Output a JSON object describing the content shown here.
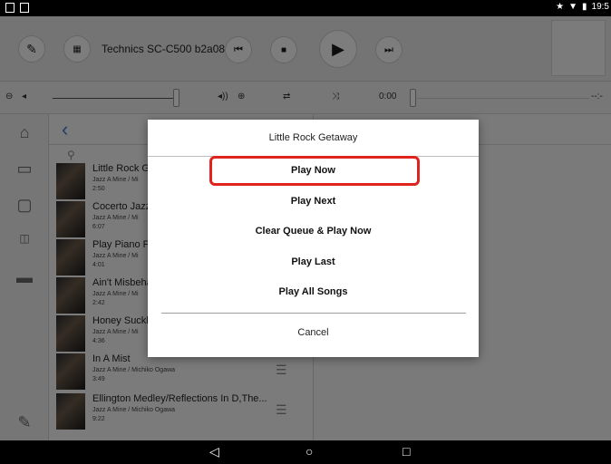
{
  "statusbar": {
    "time": "19:5",
    "icons": [
      "star-icon",
      "wifi-icon",
      "battery-icon"
    ]
  },
  "player": {
    "device_name": "Technics SC-C500 b2a083",
    "time_elapsed": "0:00",
    "time_remaining": "--:-"
  },
  "list": {
    "tracks": [
      {
        "title": "Little Rock G",
        "artist": "Jazz A Mine / Mi",
        "time": "2:50"
      },
      {
        "title": "Cocerto Jazz",
        "artist": "Jazz A Mine / Mi",
        "time": "6:07"
      },
      {
        "title": "Play Piano Pl",
        "artist": "Jazz A Mine / Mi",
        "time": "4:01"
      },
      {
        "title": "Ain't Misbeha",
        "artist": "Jazz A Mine / Mi",
        "time": "2:42"
      },
      {
        "title": "Honey Suckl",
        "artist": "Jazz A Mine / Mi",
        "time": "4:36"
      },
      {
        "title": "In A Mist",
        "artist": "Jazz A Mine / Michiko Ogawa",
        "time": "3:49"
      },
      {
        "title": "Ellington Medley/Reflections In D,The...",
        "artist": "Jazz A Mine / Michiko Ogawa",
        "time": "9:22"
      }
    ]
  },
  "queue": {
    "header_fragment": "ue"
  },
  "dialog": {
    "title": "Little Rock Getaway",
    "options": [
      "Play Now",
      "Play Next",
      "Clear Queue & Play Now",
      "Play Last",
      "Play All Songs"
    ],
    "cancel": "Cancel",
    "highlight_color": "#e0231d"
  },
  "navbar": {
    "back": "◁",
    "home": "○",
    "recents": "□"
  }
}
